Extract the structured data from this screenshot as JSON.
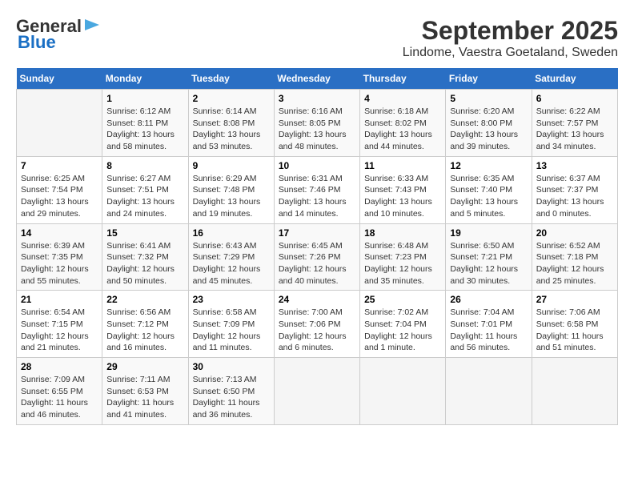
{
  "logo": {
    "line1": "General",
    "line2": "Blue"
  },
  "title": "September 2025",
  "subtitle": "Lindome, Vaestra Goetaland, Sweden",
  "weekdays": [
    "Sunday",
    "Monday",
    "Tuesday",
    "Wednesday",
    "Thursday",
    "Friday",
    "Saturday"
  ],
  "weeks": [
    [
      {
        "num": "",
        "info": ""
      },
      {
        "num": "1",
        "info": "Sunrise: 6:12 AM\nSunset: 8:11 PM\nDaylight: 13 hours\nand 58 minutes."
      },
      {
        "num": "2",
        "info": "Sunrise: 6:14 AM\nSunset: 8:08 PM\nDaylight: 13 hours\nand 53 minutes."
      },
      {
        "num": "3",
        "info": "Sunrise: 6:16 AM\nSunset: 8:05 PM\nDaylight: 13 hours\nand 48 minutes."
      },
      {
        "num": "4",
        "info": "Sunrise: 6:18 AM\nSunset: 8:02 PM\nDaylight: 13 hours\nand 44 minutes."
      },
      {
        "num": "5",
        "info": "Sunrise: 6:20 AM\nSunset: 8:00 PM\nDaylight: 13 hours\nand 39 minutes."
      },
      {
        "num": "6",
        "info": "Sunrise: 6:22 AM\nSunset: 7:57 PM\nDaylight: 13 hours\nand 34 minutes."
      }
    ],
    [
      {
        "num": "7",
        "info": "Sunrise: 6:25 AM\nSunset: 7:54 PM\nDaylight: 13 hours\nand 29 minutes."
      },
      {
        "num": "8",
        "info": "Sunrise: 6:27 AM\nSunset: 7:51 PM\nDaylight: 13 hours\nand 24 minutes."
      },
      {
        "num": "9",
        "info": "Sunrise: 6:29 AM\nSunset: 7:48 PM\nDaylight: 13 hours\nand 19 minutes."
      },
      {
        "num": "10",
        "info": "Sunrise: 6:31 AM\nSunset: 7:46 PM\nDaylight: 13 hours\nand 14 minutes."
      },
      {
        "num": "11",
        "info": "Sunrise: 6:33 AM\nSunset: 7:43 PM\nDaylight: 13 hours\nand 10 minutes."
      },
      {
        "num": "12",
        "info": "Sunrise: 6:35 AM\nSunset: 7:40 PM\nDaylight: 13 hours\nand 5 minutes."
      },
      {
        "num": "13",
        "info": "Sunrise: 6:37 AM\nSunset: 7:37 PM\nDaylight: 13 hours\nand 0 minutes."
      }
    ],
    [
      {
        "num": "14",
        "info": "Sunrise: 6:39 AM\nSunset: 7:35 PM\nDaylight: 12 hours\nand 55 minutes."
      },
      {
        "num": "15",
        "info": "Sunrise: 6:41 AM\nSunset: 7:32 PM\nDaylight: 12 hours\nand 50 minutes."
      },
      {
        "num": "16",
        "info": "Sunrise: 6:43 AM\nSunset: 7:29 PM\nDaylight: 12 hours\nand 45 minutes."
      },
      {
        "num": "17",
        "info": "Sunrise: 6:45 AM\nSunset: 7:26 PM\nDaylight: 12 hours\nand 40 minutes."
      },
      {
        "num": "18",
        "info": "Sunrise: 6:48 AM\nSunset: 7:23 PM\nDaylight: 12 hours\nand 35 minutes."
      },
      {
        "num": "19",
        "info": "Sunrise: 6:50 AM\nSunset: 7:21 PM\nDaylight: 12 hours\nand 30 minutes."
      },
      {
        "num": "20",
        "info": "Sunrise: 6:52 AM\nSunset: 7:18 PM\nDaylight: 12 hours\nand 25 minutes."
      }
    ],
    [
      {
        "num": "21",
        "info": "Sunrise: 6:54 AM\nSunset: 7:15 PM\nDaylight: 12 hours\nand 21 minutes."
      },
      {
        "num": "22",
        "info": "Sunrise: 6:56 AM\nSunset: 7:12 PM\nDaylight: 12 hours\nand 16 minutes."
      },
      {
        "num": "23",
        "info": "Sunrise: 6:58 AM\nSunset: 7:09 PM\nDaylight: 12 hours\nand 11 minutes."
      },
      {
        "num": "24",
        "info": "Sunrise: 7:00 AM\nSunset: 7:06 PM\nDaylight: 12 hours\nand 6 minutes."
      },
      {
        "num": "25",
        "info": "Sunrise: 7:02 AM\nSunset: 7:04 PM\nDaylight: 12 hours\nand 1 minute."
      },
      {
        "num": "26",
        "info": "Sunrise: 7:04 AM\nSunset: 7:01 PM\nDaylight: 11 hours\nand 56 minutes."
      },
      {
        "num": "27",
        "info": "Sunrise: 7:06 AM\nSunset: 6:58 PM\nDaylight: 11 hours\nand 51 minutes."
      }
    ],
    [
      {
        "num": "28",
        "info": "Sunrise: 7:09 AM\nSunset: 6:55 PM\nDaylight: 11 hours\nand 46 minutes."
      },
      {
        "num": "29",
        "info": "Sunrise: 7:11 AM\nSunset: 6:53 PM\nDaylight: 11 hours\nand 41 minutes."
      },
      {
        "num": "30",
        "info": "Sunrise: 7:13 AM\nSunset: 6:50 PM\nDaylight: 11 hours\nand 36 minutes."
      },
      {
        "num": "",
        "info": ""
      },
      {
        "num": "",
        "info": ""
      },
      {
        "num": "",
        "info": ""
      },
      {
        "num": "",
        "info": ""
      }
    ]
  ]
}
